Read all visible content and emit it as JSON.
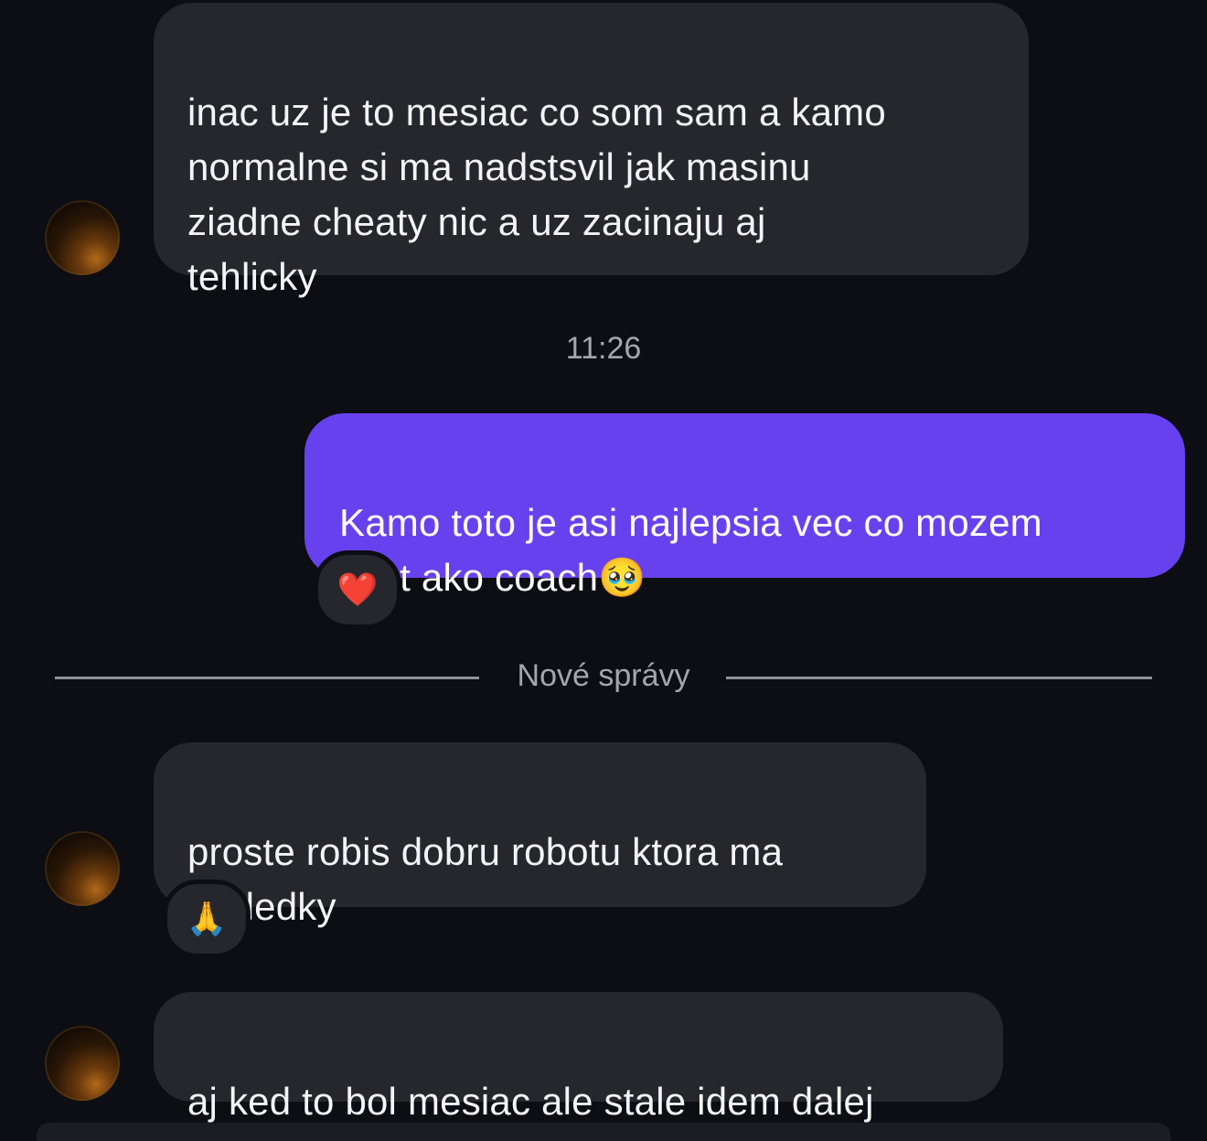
{
  "conversation": {
    "messages": [
      {
        "direction": "incoming",
        "text": "inac uz je to mesiac co som sam a kamo\nnormalne si ma nadstsvil jak masinu\nziadne cheaty nic a uz zacinaju aj\ntehlicky"
      },
      {
        "direction": "outgoing",
        "text": "Kamo toto je asi najlepsia vec co mozem\ncitat ako coach🥹",
        "reaction": "❤️"
      },
      {
        "direction": "incoming",
        "text": "proste robis dobru robotu ktora ma\nvysledky",
        "reaction": "🙏"
      },
      {
        "direction": "incoming",
        "text": "aj ked to bol mesiac ale stale idem dalej"
      }
    ],
    "timestamp": "11:26",
    "new_messages_divider": "Nové správy"
  },
  "colors": {
    "background": "#0c0e13",
    "incoming_bubble": "#25272c",
    "outgoing_bubble": "#6841ee",
    "muted_text": "#a2a6ae"
  },
  "icons": {
    "avatar": "contact-avatar"
  }
}
